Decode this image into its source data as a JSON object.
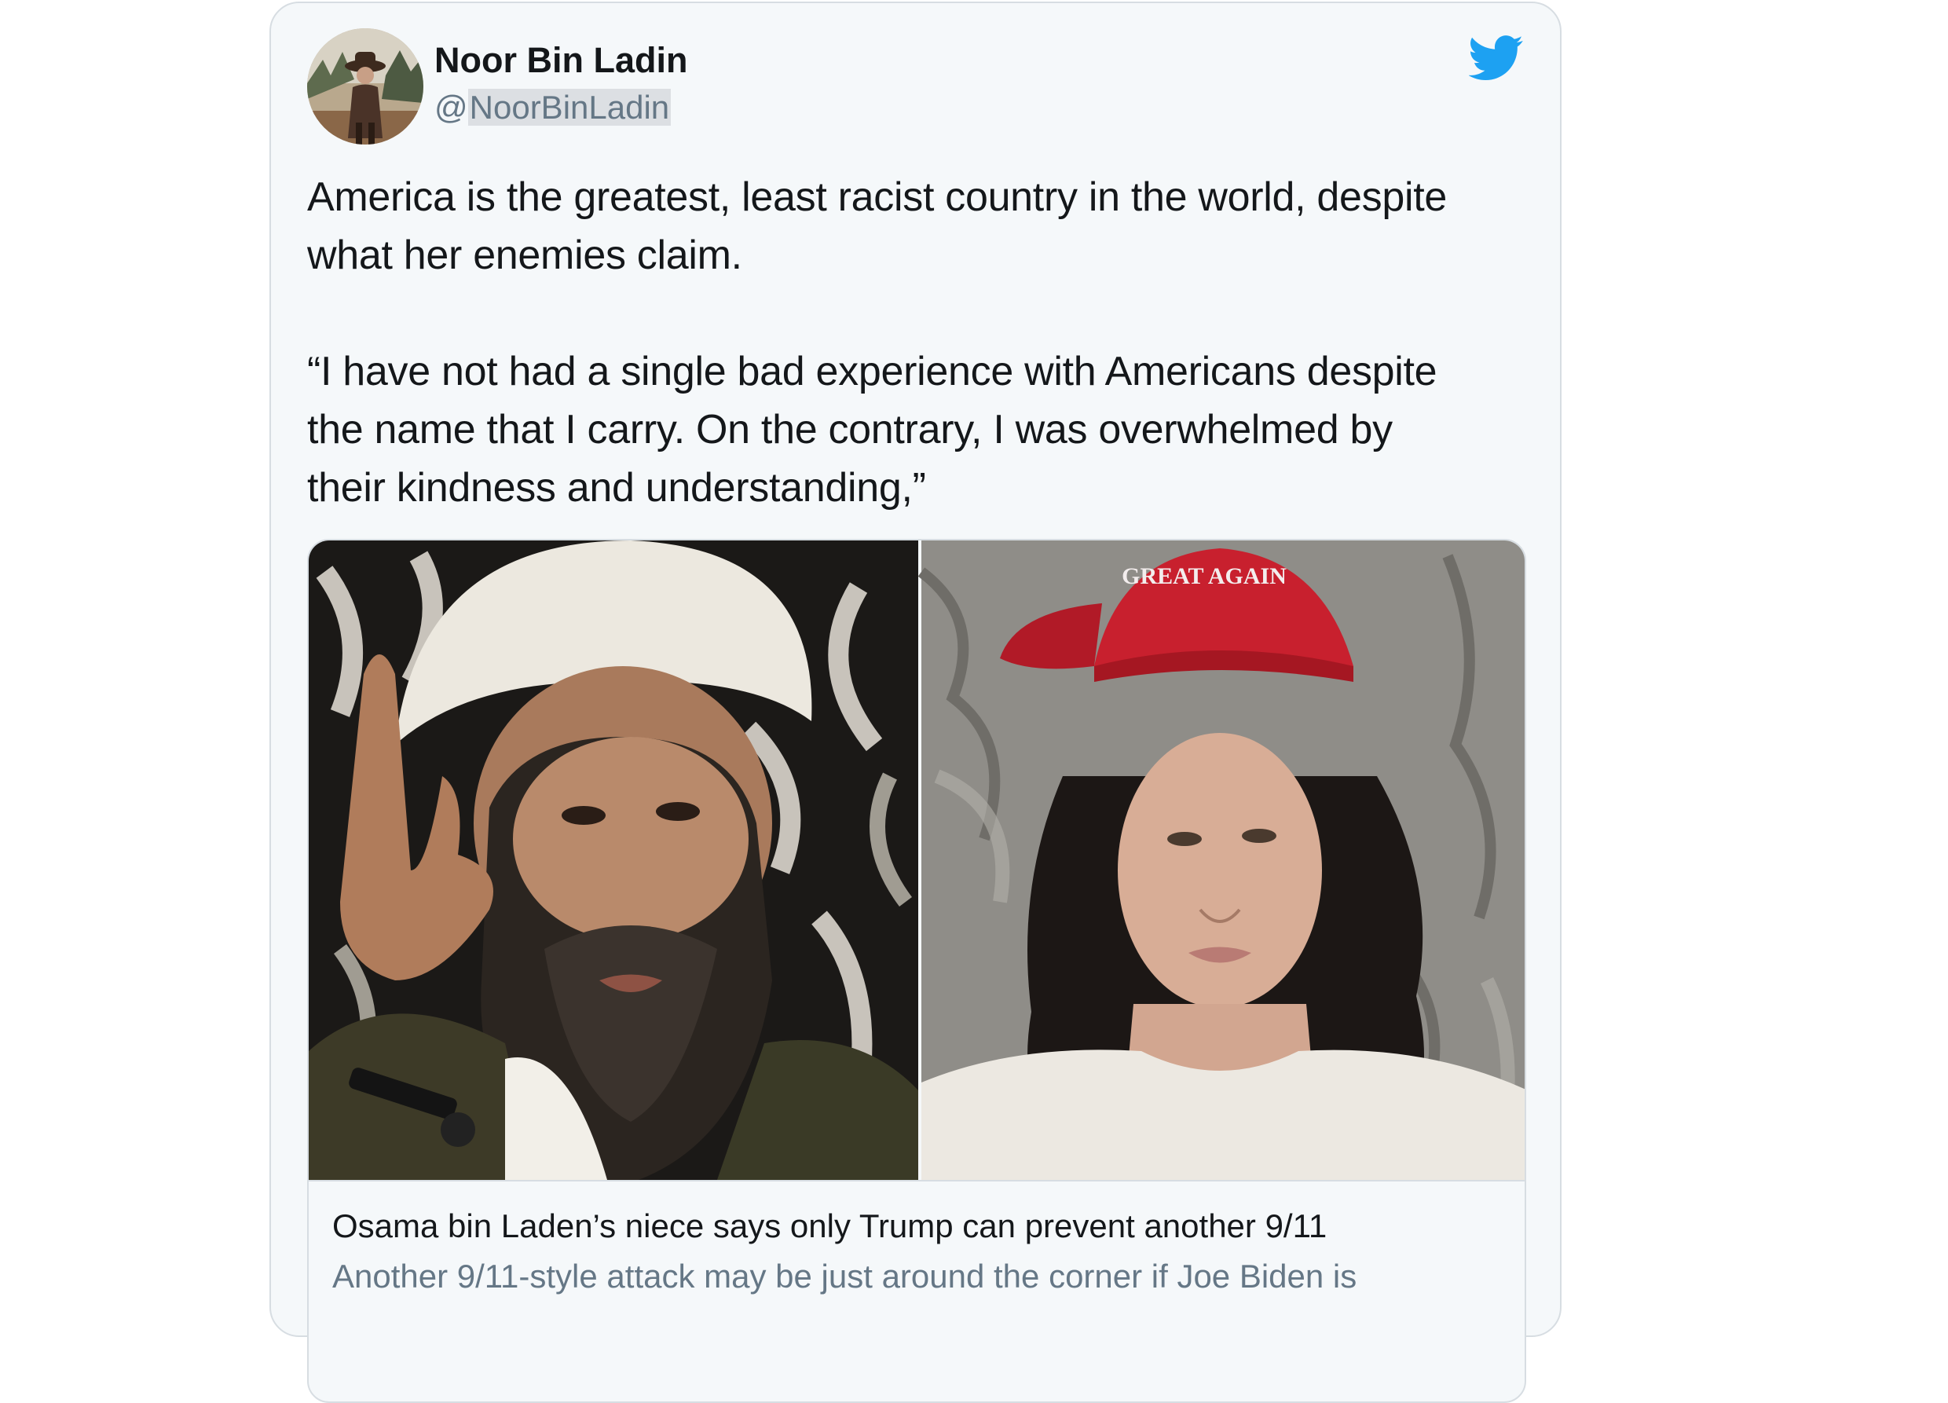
{
  "tweet": {
    "author": {
      "display_name": "Noor Bin Ladin",
      "handle_prefix": "@",
      "handle_name": "NoorBinLadin"
    },
    "text_paragraphs": [
      "America is the greatest, least racist country in the world, despite\nwhat her enemies claim.",
      "“I have not had a single bad experience with Americans despite\nthe name that I carry. On the contrary, I was overwhelmed by\ntheir kindness and understanding,”"
    ],
    "brand_icon": "twitter-bird-icon",
    "brand_color": "#1da1f2"
  },
  "link_card": {
    "image_text": "GREAT AGAIN",
    "title": "Osama bin Laden’s niece says only Trump can prevent another 9/11",
    "description": "Another 9/11-style attack may be just around the corner if Joe Biden is"
  },
  "colors": {
    "card_background": "#f5f8fa",
    "border": "#d7dde2",
    "primary_text": "#14171a",
    "secondary_text": "#657786",
    "hat_red": "#c8202e"
  }
}
